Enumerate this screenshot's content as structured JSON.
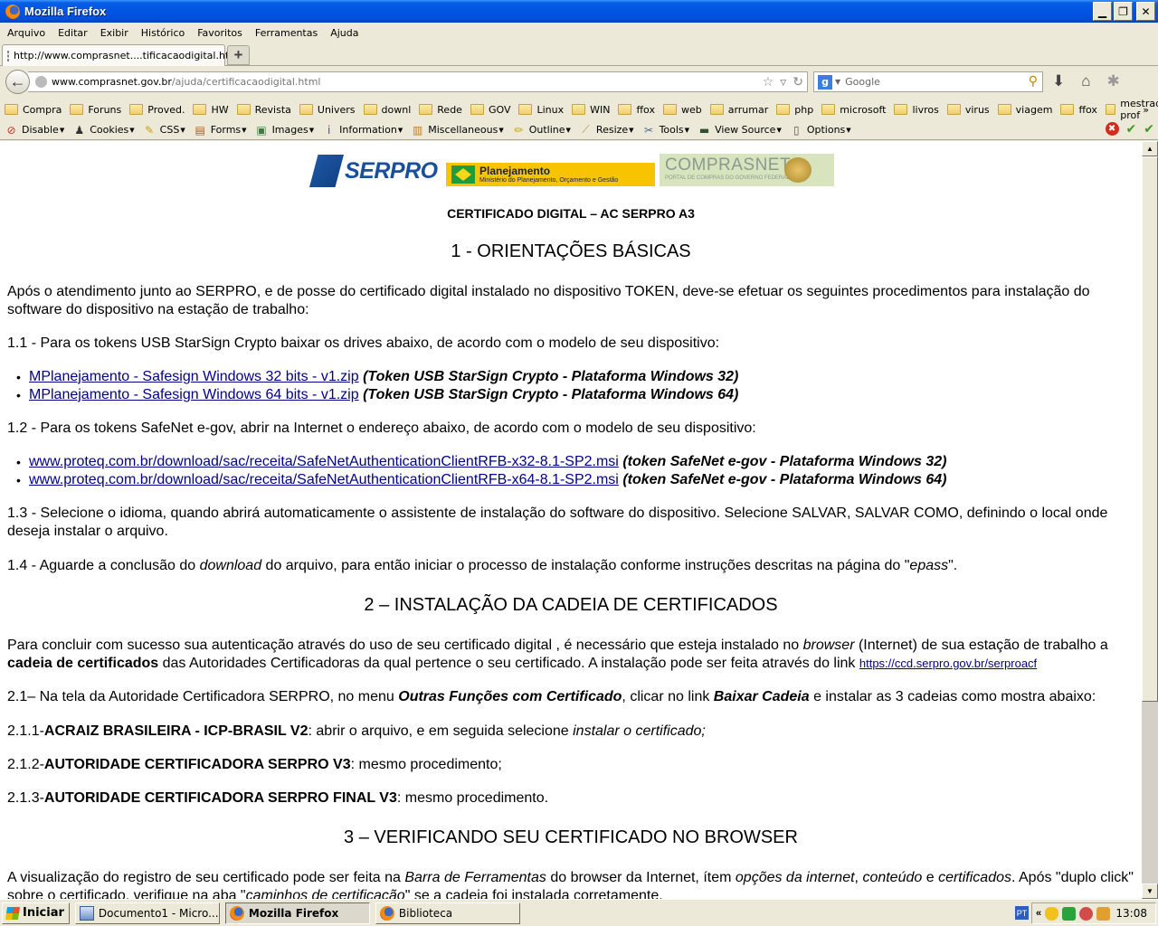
{
  "window": {
    "title": "Mozilla Firefox",
    "controls": {
      "minimize": "_",
      "restore": "🗗",
      "close": "✕"
    }
  },
  "menu": [
    "Arquivo",
    "Editar",
    "Exibir",
    "Histórico",
    "Favoritos",
    "Ferramentas",
    "Ajuda"
  ],
  "tabs": [
    {
      "label": "http://www.comprasnet....tificacaodigital.html",
      "active": true
    }
  ],
  "new_tab_label": "+",
  "navbar": {
    "url_host": "www.comprasnet.gov.br",
    "url_path": "/ajuda/certificacaodigital.html",
    "search_engine_icon": "g",
    "search_placeholder": "Google"
  },
  "bookmarks": [
    "Compra",
    "Foruns",
    "Proved.",
    "HW",
    "Revista",
    "Univers",
    "downl",
    "Rede",
    "GOV",
    "Linux",
    "WIN",
    "ffox",
    "web",
    "arrumar",
    "php",
    "microsoft",
    "livros",
    "virus",
    "viagem",
    "ffox",
    "mestrado prof"
  ],
  "bookmarks_more": "»",
  "webdev_toolbar": [
    {
      "label": "Disable",
      "icon": "⊘",
      "color": "#d42b1e"
    },
    {
      "label": "Cookies",
      "icon": "♟",
      "color": "#333333"
    },
    {
      "label": "CSS",
      "icon": "✎",
      "color": "#c9a000"
    },
    {
      "label": "Forms",
      "icon": "▤",
      "color": "#a0602a"
    },
    {
      "label": "Images",
      "icon": "▣",
      "color": "#3f7a3f"
    },
    {
      "label": "Information",
      "icon": "i",
      "color": "#1d5bd6"
    },
    {
      "label": "Miscellaneous",
      "icon": "▥",
      "color": "#c07a1f"
    },
    {
      "label": "Outline",
      "icon": "✏",
      "color": "#c9a000"
    },
    {
      "label": "Resize",
      "icon": "⟋",
      "color": "#c08a3f"
    },
    {
      "label": "Tools",
      "icon": "✂",
      "color": "#4a6b95"
    },
    {
      "label": "View Source",
      "icon": "▬",
      "color": "#2f4f2f"
    },
    {
      "label": "Options",
      "icon": "▯",
      "color": "#555555"
    }
  ],
  "webdev_status": [
    "✖",
    "✔",
    "✔"
  ],
  "page": {
    "logos": {
      "serpro": "SERPRO",
      "planejamento_title": "Planejamento",
      "planejamento_sub": "Ministério do Planejamento, Orçamento e Gestão",
      "comprasnet_title": "COMPRASNET",
      "comprasnet_sub": "PORTAL DE COMPRAS DO GOVERNO FEDERAL"
    },
    "title": "CERTIFICADO DIGITAL – AC SERPRO A3",
    "section1": {
      "heading": "1 - ORIENTAÇÕES BÁSICAS",
      "intro": "Após o atendimento junto ao SERPRO, e de posse do certificado digital instalado no dispositivo TOKEN, deve-se efetuar os seguintes procedimentos para instalação do software do dispositivo na estação de trabalho:",
      "p11": "1.1 - Para os tokens USB StarSign Crypto baixar os drives abaixo, de acordo com o modelo de seu dispositivo:",
      "links11": [
        {
          "text": "MPlanejamento - Safesign Windows 32 bits - v1.zip",
          "note": "(Token USB StarSign Crypto - Plataforma Windows 32)"
        },
        {
          "text": "MPlanejamento - Safesign Windows 64 bits - v1.zip",
          "note": "(Token USB StarSign Crypto - Plataforma Windows 64)"
        }
      ],
      "p12": "1.2 - Para os tokens SafeNet e-gov, abrir na Internet o endereço abaixo, de acordo com o modelo de seu dispositivo:",
      "links12": [
        {
          "text": "www.proteq.com.br/download/sac/receita/SafeNetAuthenticationClientRFB-x32-8.1-SP2.msi",
          "note": "(token SafeNet e-gov - Plataforma Windows 32)"
        },
        {
          "text": "www.proteq.com.br/download/sac/receita/SafeNetAuthenticationClientRFB-x64-8.1-SP2.msi",
          "note": "(token SafeNet e-gov - Plataforma Windows 64)"
        }
      ],
      "p13": "1.3 - Selecione o idioma, quando abrirá automaticamente o assistente de instalação do software do dispositivo. Selecione SALVAR, SALVAR COMO, definindo o local onde deseja instalar o arquivo.",
      "p14_a": "1.4 - Aguarde a conclusão do ",
      "p14_em": "download",
      "p14_b": " do arquivo, para então iniciar o processo de instalação conforme instruções descritas na página do \"",
      "p14_em2": "epass",
      "p14_c": "\"."
    },
    "section2": {
      "heading": "2 – INSTALAÇÃO DA CADEIA DE CERTIFICADOS",
      "p_a": "Para concluir com sucesso sua autenticação através do uso de seu certificado digital , é necessário que esteja instalado no ",
      "p_em": "browser",
      "p_b": " (Internet) de sua estação de trabalho a ",
      "p_bold": "cadeia de certificados",
      "p_c": " das Autoridades Certificadoras da qual pertence o seu certificado. A instalação pode ser feita através do link ",
      "p_link": "https://ccd.serpro.gov.br/serproacf",
      "p21_a": "2.1– Na tela da Autoridade Certificadora SERPRO, no menu ",
      "p21_bi1": "Outras Funções com Certificado",
      "p21_b": ", clicar no link ",
      "p21_bi2": "Baixar Cadeia",
      "p21_c": " e instalar as 3 cadeias como mostra abaixo:",
      "p211_num": "2.1.1-",
      "p211_bold": "ACRAIZ BRASILEIRA - ICP-BRASIL V2",
      "p211_a": ": abrir o arquivo, e em seguida selecione ",
      "p211_em": "instalar o certificado;",
      "p212_num": "2.1.2-",
      "p212_bold": "AUTORIDADE CERTIFICADORA SERPRO V3",
      "p212_a": ": mesmo procedimento;",
      "p213_num": "2.1.3-",
      "p213_bold": "AUTORIDADE CERTIFICADORA SERPRO FINAL V3",
      "p213_a": ": mesmo procedimento."
    },
    "section3": {
      "heading": "3 – VERIFICANDO SEU CERTIFICADO NO BROWSER",
      "p_a": "A visualização do registro de seu certificado pode ser feita na ",
      "p_em1": "Barra de Ferramentas",
      "p_b": " do browser da Internet, ítem ",
      "p_em2": "opções da internet",
      "p_c": ", ",
      "p_em3": "conteúdo",
      "p_d": " e ",
      "p_em4": "certificados",
      "p_e": ". Após \"duplo click\" sobre o certificado, verifique na aba \"",
      "p_em5": "caminhos de certificação",
      "p_f": "\" se a cadeia foi instalada corretamente."
    }
  },
  "scrollbar": {
    "position_fraction": 0.0,
    "visible_fraction": 0.75
  },
  "taskbar": {
    "start_label": "Iniciar",
    "tasks": [
      {
        "label": "Documento1 - Micro...",
        "icon": "word",
        "active": false
      },
      {
        "label": "Mozilla Firefox",
        "icon": "firefox",
        "active": true
      },
      {
        "label": "Biblioteca",
        "icon": "firefox",
        "active": false
      }
    ],
    "language": "PT",
    "tray_expand": "«",
    "clock": "13:08"
  }
}
